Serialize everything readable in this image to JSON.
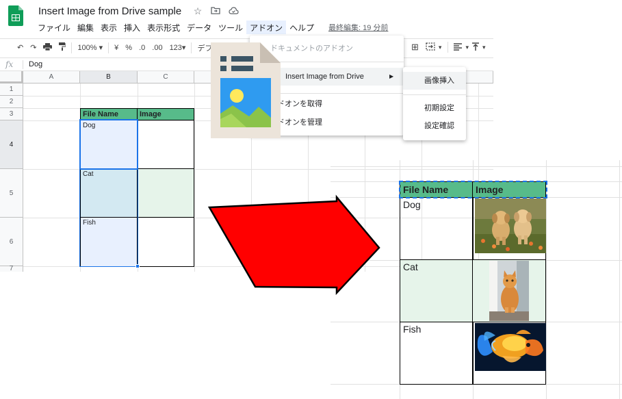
{
  "app": {
    "doc_title": "Insert Image from Drive sample",
    "last_edit": "最終編集: 19 分前",
    "brand_color": "#0f9d58",
    "title_icons": [
      "star-icon",
      "folder-move-icon",
      "cloud-status-icon"
    ]
  },
  "menubar": {
    "items": [
      "ファイル",
      "編集",
      "表示",
      "挿入",
      "表示形式",
      "データ",
      "ツール",
      "アドオン",
      "ヘルプ"
    ],
    "active": "アドオン"
  },
  "toolbar": {
    "zoom": "100%",
    "currency": "¥",
    "percent": "%",
    "decimal_decrease": ".0",
    "decimal_increase": ".00",
    "more_formats": "123",
    "font_partial": "デフォル"
  },
  "formula_bar": {
    "fx": "fx",
    "value": "Dog"
  },
  "grid": {
    "columns": [
      "A",
      "B",
      "C"
    ],
    "rows": [
      "1",
      "2",
      "3",
      "4",
      "5",
      "6",
      "7"
    ],
    "table_header": [
      "File Name",
      "Image"
    ],
    "table_rows": [
      "Dog",
      "Cat",
      "Fish"
    ]
  },
  "addon_menu": {
    "header": "ドキュメントのアドオン",
    "item_insert": "Insert Image from Drive",
    "item_get": "ドオンを取得",
    "item_manage": "ドオンを管理"
  },
  "submenu": {
    "items": [
      "画像挿入",
      "初期設定",
      "設定確認"
    ]
  },
  "result": {
    "table_header": [
      "File Name",
      "Image"
    ],
    "table_rows": [
      "Dog",
      "Cat",
      "Fish"
    ],
    "images": [
      "puppies-photo",
      "cat-photo",
      "goldfish-photo"
    ]
  },
  "colors": {
    "header_green": "#57bb8a",
    "light_green": "#e6f4ea",
    "selection_blue": "#1a73e8",
    "arrow_red": "#ff0000"
  }
}
